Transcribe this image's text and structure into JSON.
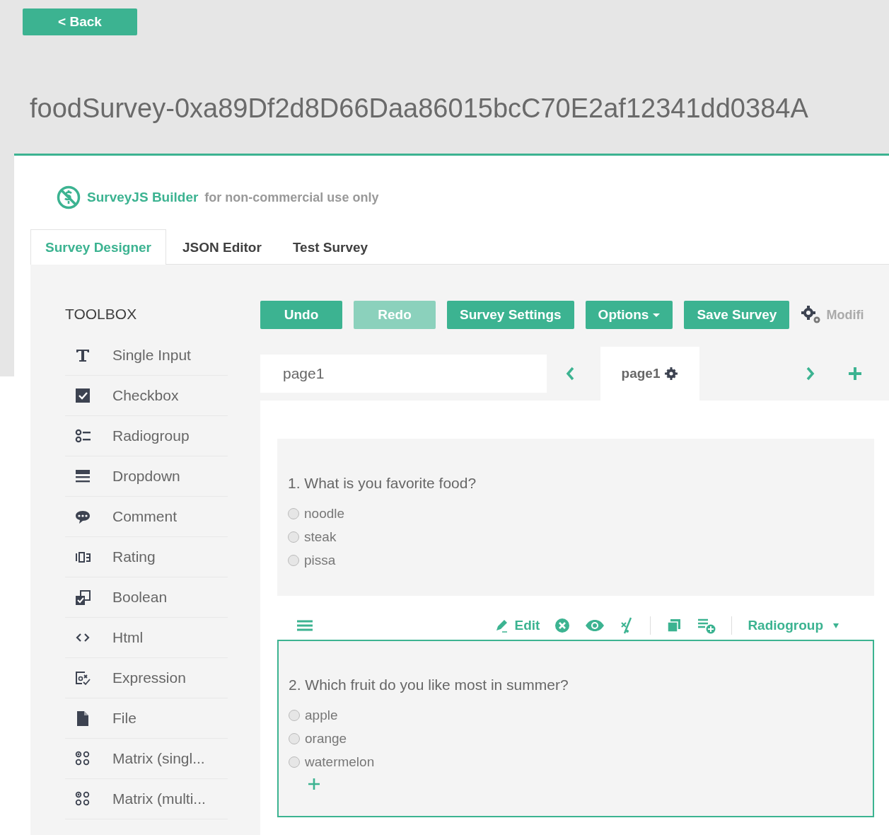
{
  "back_button": {
    "label": "< Back"
  },
  "title": "foodSurvey-0xa89Df2d8D66Daa86015bcC70E2af12341dd0384A",
  "brand": {
    "name": "SurveyJS Builder",
    "note": "for non-commercial use only"
  },
  "tabs": [
    {
      "label": "Survey Designer",
      "selected": true
    },
    {
      "label": "JSON Editor",
      "selected": false
    },
    {
      "label": "Test Survey",
      "selected": false
    }
  ],
  "toolbox": {
    "title": "TOOLBOX",
    "items": [
      {
        "label": "Single Input",
        "kind": "text"
      },
      {
        "label": "Checkbox",
        "kind": "checkbox"
      },
      {
        "label": "Radiogroup",
        "kind": "radiogroup"
      },
      {
        "label": "Dropdown",
        "kind": "dropdown"
      },
      {
        "label": "Comment",
        "kind": "comment"
      },
      {
        "label": "Rating",
        "kind": "rating"
      },
      {
        "label": "Boolean",
        "kind": "boolean"
      },
      {
        "label": "Html",
        "kind": "html"
      },
      {
        "label": "Expression",
        "kind": "expression"
      },
      {
        "label": "File",
        "kind": "file"
      },
      {
        "label": "Matrix (singl...",
        "kind": "matrix"
      },
      {
        "label": "Matrix (multi...",
        "kind": "matrix"
      }
    ]
  },
  "toolbar": {
    "buttons": [
      {
        "label": "Undo",
        "kind": "plain",
        "disabled": false
      },
      {
        "label": "Redo",
        "kind": "plain",
        "disabled": true
      },
      {
        "label": "Survey Settings",
        "kind": "plain",
        "disabled": false
      },
      {
        "label": "Options",
        "kind": "dropdown",
        "disabled": false
      },
      {
        "label": "Save Survey",
        "kind": "plain",
        "disabled": false
      }
    ],
    "status": "Modifi"
  },
  "pages": {
    "name_value": "page1",
    "tabs": [
      {
        "label": "page1",
        "selected": true
      }
    ]
  },
  "questions": [
    {
      "title": "1. What is you favorite food?",
      "selected": false,
      "choices": [
        {
          "label": "noodle",
          "selected": false
        },
        {
          "label": "steak",
          "selected": false
        },
        {
          "label": "pissa",
          "selected": false
        }
      ]
    },
    {
      "title": "2. Which fruit do you like most in summer?",
      "selected": true,
      "choices": [
        {
          "label": "apple",
          "selected": false
        },
        {
          "label": "orange",
          "selected": false
        },
        {
          "label": "watermelon",
          "selected": false
        }
      ]
    }
  ],
  "question_toolbar": {
    "edit": "Edit",
    "type": "Radiogroup"
  }
}
